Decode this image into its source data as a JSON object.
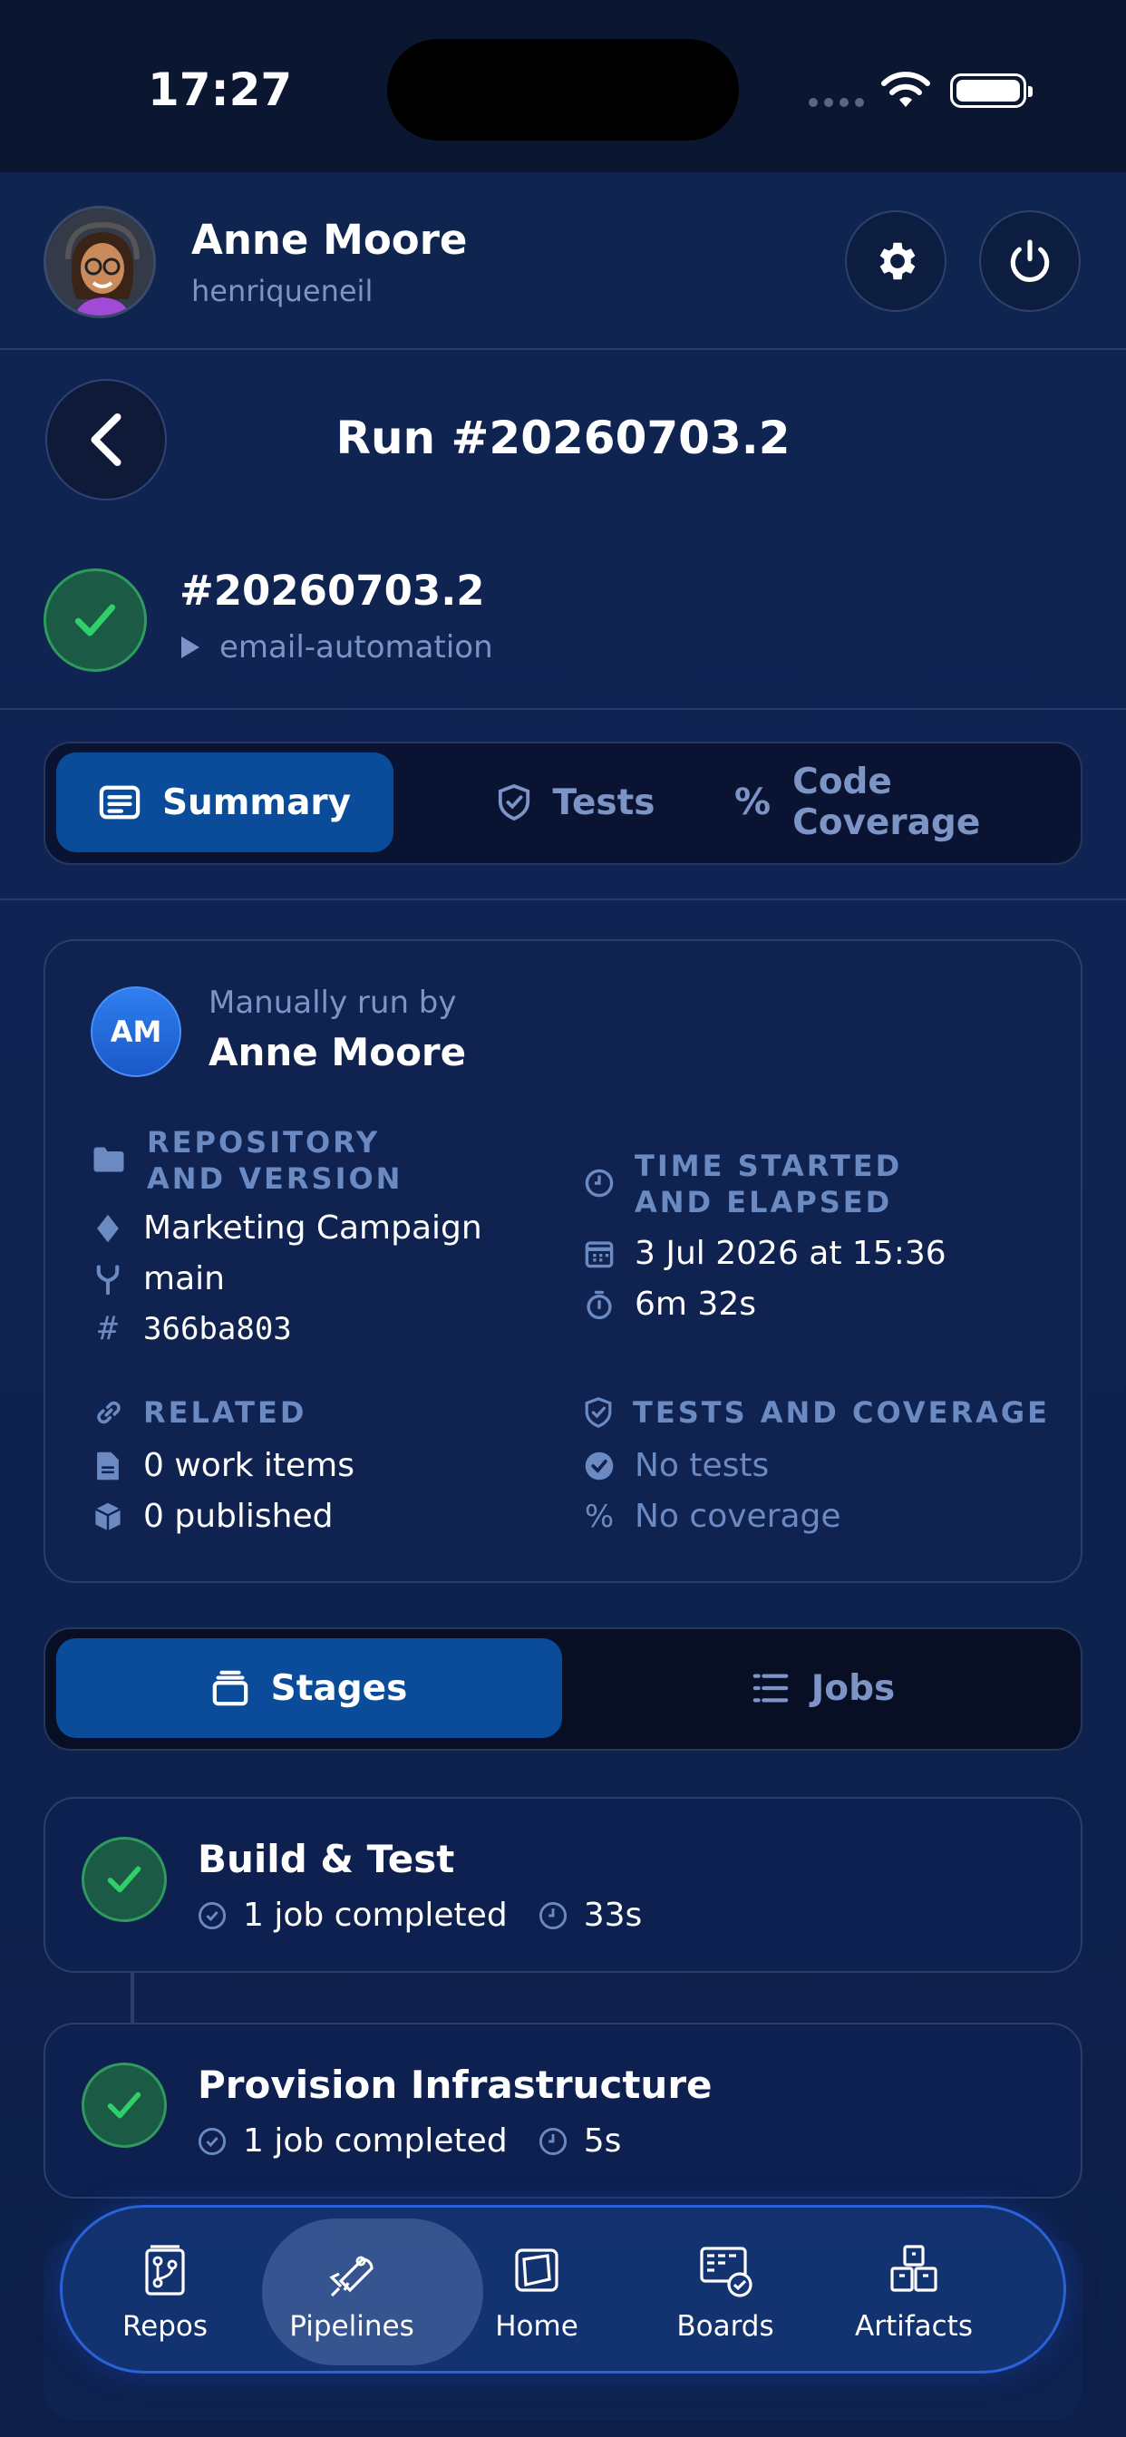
{
  "status_bar": {
    "time": "17:27"
  },
  "profile": {
    "name": "Anne Moore",
    "handle": "henriqueneil"
  },
  "nav": {
    "title": "Run #20260703.2"
  },
  "run": {
    "id": "#20260703.2",
    "pipeline": "email-automation",
    "status": "succeeded"
  },
  "tabs": [
    {
      "label": "Summary",
      "icon": "summary-icon",
      "active": true
    },
    {
      "label": "Tests",
      "icon": "shield-icon",
      "active": false
    },
    {
      "label": "Code Coverage",
      "icon": "percent-icon",
      "active": false
    }
  ],
  "summary": {
    "run_by_label": "Manually run by",
    "run_by_name": "Anne Moore",
    "initials": "AM",
    "repo_label_1": "REPOSITORY",
    "repo_label_2": "AND VERSION",
    "repo_name": "Marketing Campaign",
    "branch": "main",
    "commit": "366ba803",
    "time_label_1": "TIME STARTED",
    "time_label_2": "AND ELAPSED",
    "started": "3 Jul 2026 at 15:36",
    "elapsed": "6m 32s",
    "related_label": "RELATED",
    "work_items": "0 work items",
    "published": "0 published",
    "tests_label": "TESTS AND COVERAGE",
    "tests": "No tests",
    "coverage": "No coverage"
  },
  "view_toggle": [
    {
      "label": "Stages",
      "active": true
    },
    {
      "label": "Jobs",
      "active": false
    }
  ],
  "stages": [
    {
      "title": "Build & Test",
      "jobs": "1 job completed",
      "duration": "33s"
    },
    {
      "title": "Provision Infrastructure",
      "jobs": "1 job completed",
      "duration": "5s"
    }
  ],
  "bottom_tabs": [
    {
      "label": "Repos",
      "icon": "repos-icon",
      "active": false
    },
    {
      "label": "Pipelines",
      "icon": "pipelines-icon",
      "active": true
    },
    {
      "label": "Home",
      "icon": "home-icon",
      "active": false
    },
    {
      "label": "Boards",
      "icon": "boards-icon",
      "active": false
    },
    {
      "label": "Artifacts",
      "icon": "artifacts-icon",
      "active": false
    }
  ],
  "colors": {
    "accent": "#0a4c9a",
    "success": "#2fd06a",
    "muted": "#7c95c6",
    "background": "#0f2350"
  }
}
